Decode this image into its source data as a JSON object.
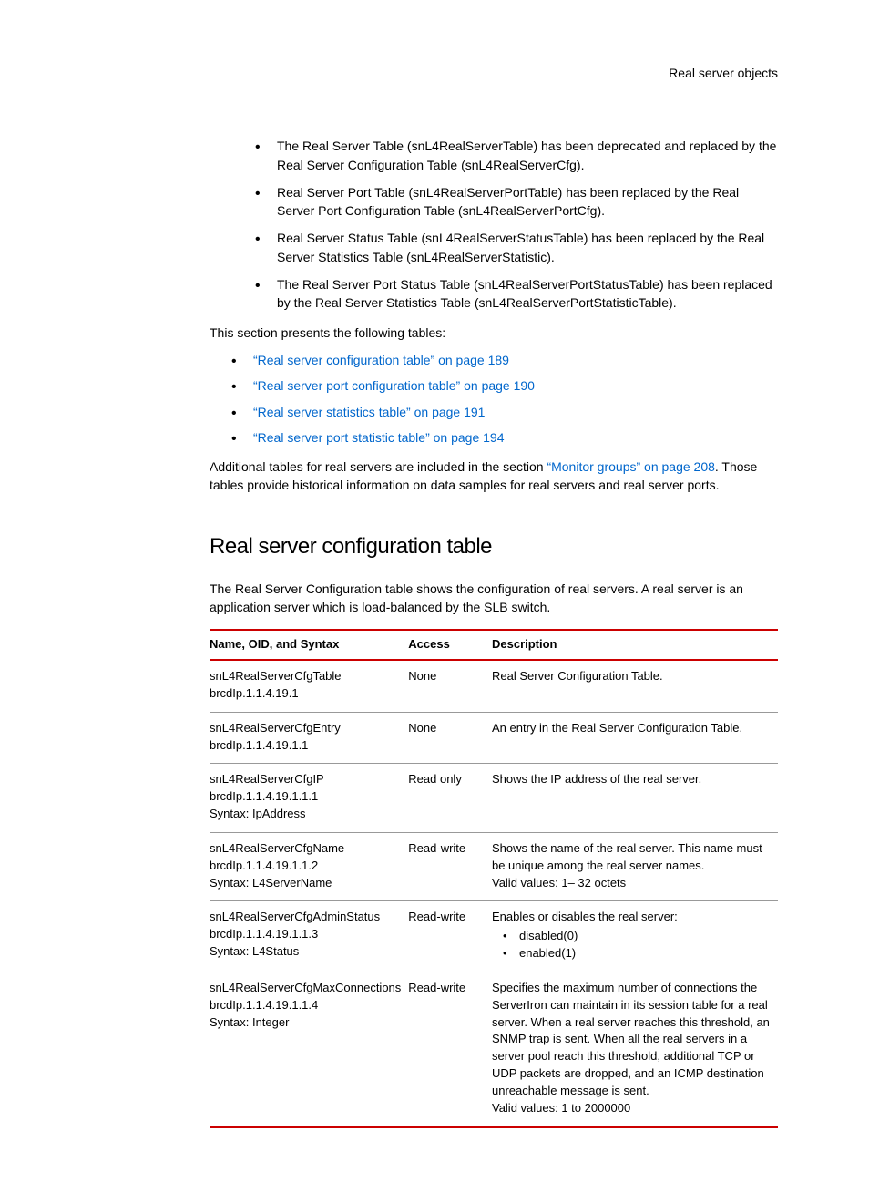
{
  "header": {
    "title": "Real server objects"
  },
  "intro_bullets": [
    "The Real Server Table (snL4RealServerTable) has been deprecated and replaced by the Real Server Configuration Table (snL4RealServerCfg).",
    "Real Server Port Table (snL4RealServerPortTable) has been replaced by the Real Server Port Configuration Table (snL4RealServerPortCfg).",
    "Real Server Status Table (snL4RealServerStatusTable) has been replaced by the Real Server Statistics Table (snL4RealServerStatistic).",
    "The Real Server Port Status Table (snL4RealServerPortStatusTable) has been replaced by the Real Server Statistics Table (snL4RealServerPortStatisticTable)."
  ],
  "section_intro": "This section presents the following tables:",
  "toc_links": [
    "“Real server configuration table” on page 189",
    "“Real server port configuration table” on page 190",
    "“Real server statistics table” on page 191",
    "“Real server port statistic table” on page 194"
  ],
  "additional_prefix": "Additional tables for real servers are included in the section ",
  "additional_link": "“Monitor groups” on page 208",
  "additional_suffix": ". Those tables provide historical information on data samples for real servers and real server ports.",
  "heading": "Real server configuration table",
  "heading_para": "The Real Server Configuration table shows the configuration of real servers. A real server is an application server which is load-balanced by the SLB switch.",
  "table": {
    "headers": {
      "c1": "Name, OID, and Syntax",
      "c2": "Access",
      "c3": "Description"
    },
    "rows": [
      {
        "name_lines": [
          "snL4RealServerCfgTable",
          "brcdIp.1.1.4.19.1"
        ],
        "access": "None",
        "desc_lines": [
          "Real Server Configuration Table."
        ],
        "desc_bullets": []
      },
      {
        "name_lines": [
          "snL4RealServerCfgEntry",
          "brcdIp.1.1.4.19.1.1"
        ],
        "access": "None",
        "desc_lines": [
          "An entry in the Real Server Configuration Table."
        ],
        "desc_bullets": []
      },
      {
        "name_lines": [
          "snL4RealServerCfgIP",
          "brcdIp.1.1.4.19.1.1.1",
          "Syntax: IpAddress"
        ],
        "access": "Read only",
        "desc_lines": [
          "Shows the IP address of the real server."
        ],
        "desc_bullets": []
      },
      {
        "name_lines": [
          "snL4RealServerCfgName",
          "brcdIp.1.1.4.19.1.1.2",
          "Syntax: L4ServerName"
        ],
        "access": "Read-write",
        "desc_lines": [
          "Shows the name of the real server. This name must be unique among the real server names.",
          "Valid values: 1– 32 octets"
        ],
        "desc_bullets": []
      },
      {
        "name_lines": [
          "snL4RealServerCfgAdminStatus",
          "brcdIp.1.1.4.19.1.1.3",
          "Syntax: L4Status"
        ],
        "access": "Read-write",
        "desc_lines": [
          "Enables or disables the real server:"
        ],
        "desc_bullets": [
          "disabled(0)",
          "enabled(1)"
        ]
      },
      {
        "name_lines": [
          "snL4RealServerCfgMaxConnections",
          "brcdIp.1.1.4.19.1.1.4",
          "Syntax: Integer"
        ],
        "access": "Read-write",
        "desc_lines": [
          "Specifies the maximum number of connections the ServerIron can maintain in its session table for a real server. When a real server reaches this threshold, an SNMP trap is sent. When all the real servers in a server pool reach this threshold, additional TCP or UDP packets are dropped, and an ICMP destination unreachable message is sent.",
          "Valid values: 1 to 2000000"
        ],
        "desc_bullets": []
      }
    ]
  }
}
